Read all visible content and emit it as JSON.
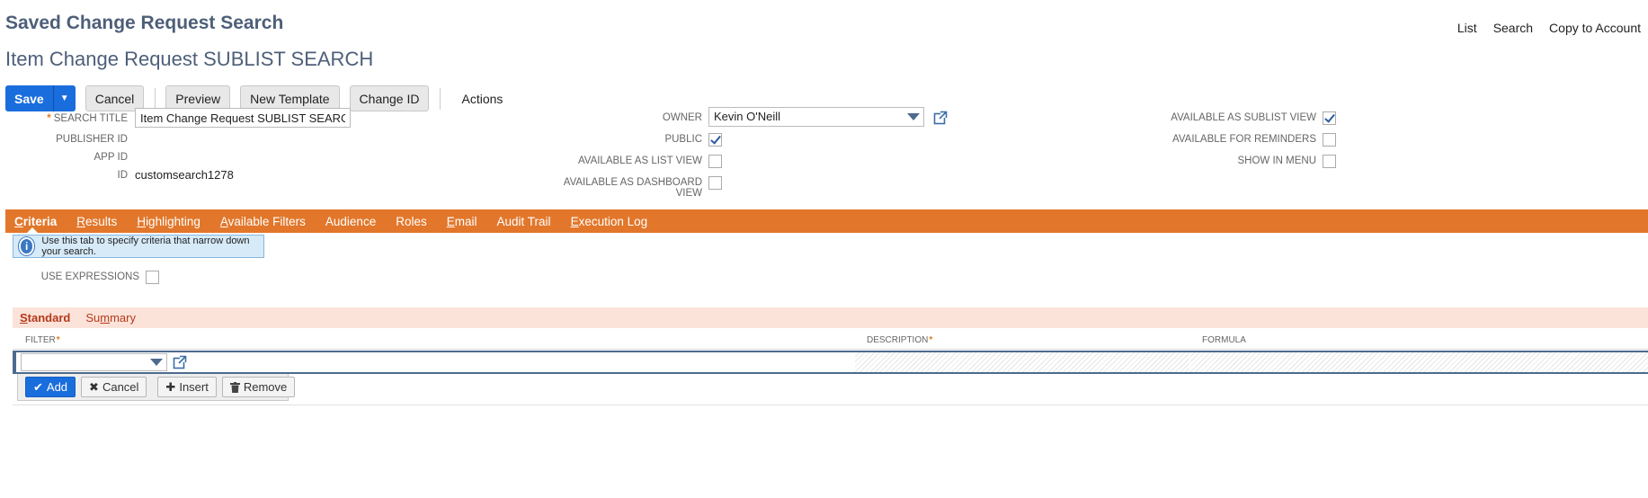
{
  "page": {
    "title": "Saved Change Request Search",
    "record_title": "Item Change Request SUBLIST SEARCH"
  },
  "top_links": {
    "list": "List",
    "search": "Search",
    "copy": "Copy to Account"
  },
  "toolbar": {
    "save": "Save",
    "cancel": "Cancel",
    "preview": "Preview",
    "new_template": "New Template",
    "change_id": "Change ID",
    "actions": "Actions"
  },
  "fields": {
    "search_title": {
      "label": "SEARCH TITLE",
      "value": "Item Change Request SUBLIST SEARCH"
    },
    "publisher_id": {
      "label": "PUBLISHER ID",
      "value": ""
    },
    "app_id": {
      "label": "APP ID",
      "value": ""
    },
    "id": {
      "label": "ID",
      "value": "customsearch1278"
    },
    "owner": {
      "label": "OWNER",
      "value": "Kevin O'Neill"
    },
    "public": {
      "label": "PUBLIC",
      "checked": true
    },
    "available_list_view": {
      "label": "AVAILABLE AS LIST VIEW",
      "checked": false
    },
    "available_dashboard_view": {
      "label_line1": "AVAILABLE AS DASHBOARD",
      "label_line2": "VIEW",
      "checked": false
    },
    "available_sublist_view": {
      "label": "AVAILABLE AS SUBLIST VIEW",
      "checked": true
    },
    "available_reminders": {
      "label": "AVAILABLE FOR REMINDERS",
      "checked": false
    },
    "show_in_menu": {
      "label": "SHOW IN MENU",
      "checked": false
    }
  },
  "tabs": [
    {
      "first": "C",
      "rest": "riteria",
      "active": true
    },
    {
      "first": "R",
      "rest": "esults"
    },
    {
      "first": "H",
      "rest": "ighlighting"
    },
    {
      "first": "A",
      "rest": "vailable Filters"
    },
    {
      "first": "Au",
      "rest": "dience"
    },
    {
      "first": "Ro",
      "rest": "les"
    },
    {
      "first": "E",
      "rest": "mail"
    },
    {
      "first": "Au",
      "rest": "dit Trail"
    },
    {
      "first": "E",
      "rest": "xecution Log"
    }
  ],
  "info": {
    "text": "Use this tab to specify criteria that narrow down your search."
  },
  "use_expressions": {
    "label": "USE EXPRESSIONS",
    "checked": false
  },
  "subtabs": {
    "standard": {
      "first": "S",
      "rest": "tandard"
    },
    "summary": {
      "pre": "Su",
      "u": "m",
      "rest": "mary"
    }
  },
  "grid": {
    "columns": {
      "filter": "FILTER",
      "description": "DESCRIPTION",
      "formula": "FORMULA"
    }
  },
  "row_buttons": {
    "add": "Add",
    "cancel": "Cancel",
    "insert": "Insert",
    "remove": "Remove"
  },
  "colors": {
    "accent": "#e2772b",
    "primary": "#1a6ddd",
    "title": "#4d5f79"
  },
  "icons": {
    "external_link": "open-in-new-icon",
    "info": "info-icon",
    "check": "check-icon",
    "plus": "plus-icon",
    "trash": "trash-icon",
    "close": "close-icon"
  }
}
